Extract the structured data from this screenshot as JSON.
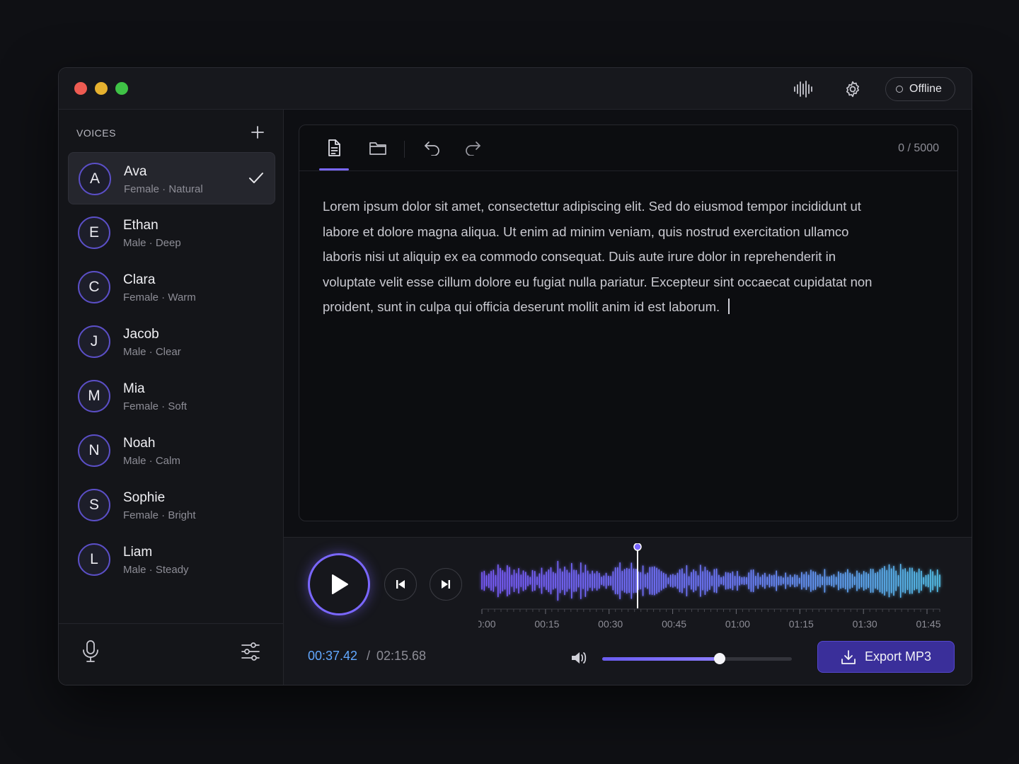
{
  "titlebar": {
    "status_label": "Offline"
  },
  "sidebar": {
    "header": "VOICES",
    "voices": [
      {
        "initial": "A",
        "name": "Ava",
        "meta": "Female · Natural",
        "selected": true
      },
      {
        "initial": "E",
        "name": "Ethan",
        "meta": "Male · Deep",
        "selected": false
      },
      {
        "initial": "C",
        "name": "Clara",
        "meta": "Female · Warm",
        "selected": false
      },
      {
        "initial": "J",
        "name": "Jacob",
        "meta": "Male · Clear",
        "selected": false
      },
      {
        "initial": "M",
        "name": "Mia",
        "meta": "Female · Soft",
        "selected": false
      },
      {
        "initial": "N",
        "name": "Noah",
        "meta": "Male · Calm",
        "selected": false
      },
      {
        "initial": "S",
        "name": "Sophie",
        "meta": "Female · Bright",
        "selected": false
      },
      {
        "initial": "L",
        "name": "Liam",
        "meta": "Male · Steady",
        "selected": false
      }
    ]
  },
  "editor": {
    "char_count": "0 / 5000",
    "text": "Lorem ipsum dolor sit amet, consectettur adipiscing elit. Sed do eiusmod tempor incididunt ut labore et dolore magna aliqua. Ut enim ad minim veniam, quis nostrud exercitation ullamco laboris nisi ut aliquip ex ea commodo consequat. Duis aute irure dolor in reprehenderit in voluptate velit esse cillum dolore eu fugiat nulla pariatur. Excepteur sint occaecat cupidatat non proident, sunt in culpa qui officia deserunt mollit anim id est laborum."
  },
  "player": {
    "current_time": "00:37.42",
    "separator": "/",
    "total_time": "02:15.68",
    "timeline_labels": [
      "00:00",
      "00:15",
      "00:30",
      "00:45",
      "01:00",
      "01:15",
      "01:30",
      "01:45"
    ],
    "playhead_position": 0.34,
    "volume": 0.62,
    "export_label": "Export MP3"
  },
  "colors": {
    "accent": "#7a67ff",
    "time_current": "#62a8ff",
    "export_bg": "#3a2f9a",
    "red": "#ee5b52",
    "yellow": "#e6b12f",
    "green": "#3fc246"
  },
  "icons": {
    "titlebar": [
      "waveform-icon",
      "gear-icon",
      "status-circle-icon"
    ],
    "editor_toolbar": [
      "document-icon",
      "folder-icon",
      "undo-icon",
      "redo-icon"
    ],
    "player": [
      "play-icon",
      "skip-previous-icon",
      "skip-next-icon",
      "volume-icon",
      "download-icon"
    ],
    "sidebar": [
      "plus-icon",
      "check-icon",
      "microphone-icon",
      "sliders-icon"
    ]
  }
}
